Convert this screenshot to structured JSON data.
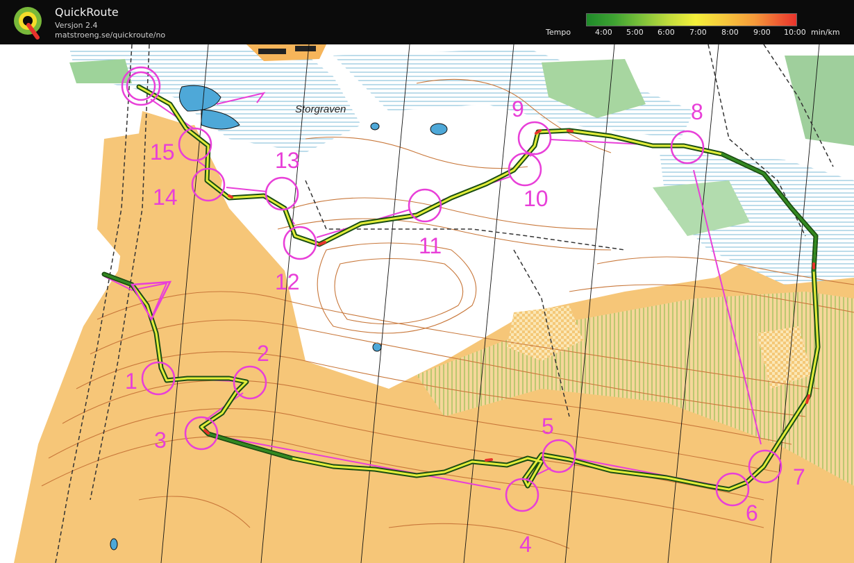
{
  "app": {
    "title": "QuickRoute",
    "version": "Versjon 2.4",
    "url": "matstroeng.se/quickroute/no"
  },
  "tempo": {
    "label": "Tempo",
    "ticks": [
      "4:00",
      "5:00",
      "6:00",
      "7:00",
      "8:00",
      "9:00",
      "10:00"
    ],
    "unit": "min/km",
    "gradient_colors": [
      "#1f8a2a",
      "#7cc13a",
      "#f4ef3a",
      "#f59a3a",
      "#e8332c"
    ]
  },
  "map": {
    "place_name": "Storgraven",
    "course_color": "#e83fd8",
    "route_color": "#e3ee3a",
    "controls": [
      "1",
      "2",
      "3",
      "4",
      "5",
      "6",
      "7",
      "8",
      "9",
      "10",
      "11",
      "12",
      "13",
      "14",
      "15"
    ]
  }
}
